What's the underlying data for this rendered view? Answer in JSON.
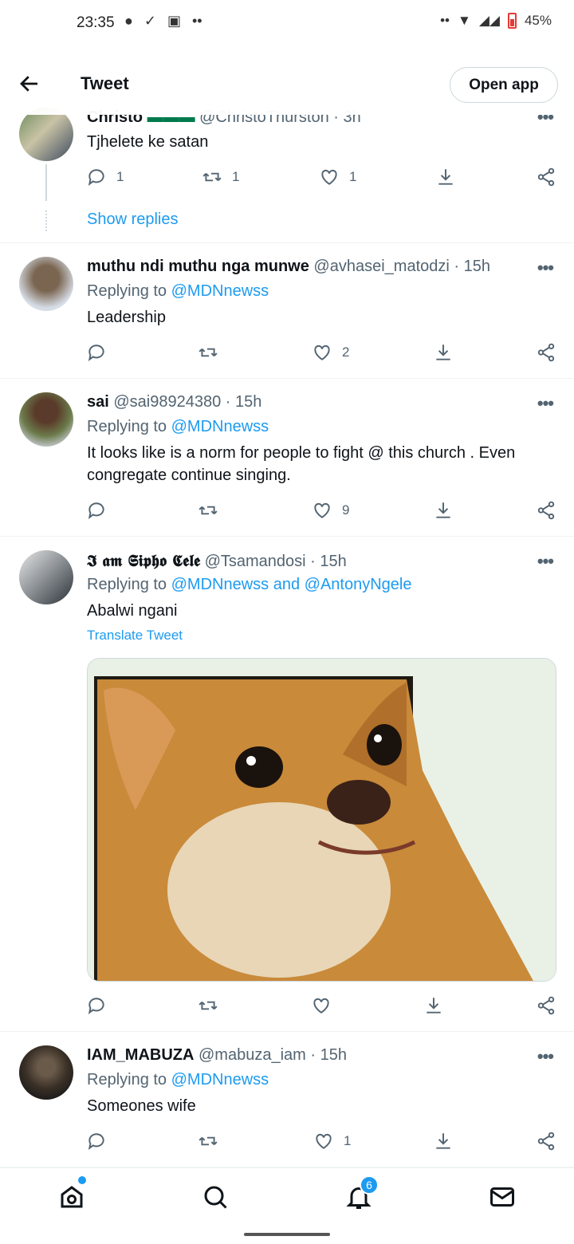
{
  "status_bar": {
    "time": "23:35",
    "battery": "45%"
  },
  "header": {
    "title": "Tweet",
    "open_app": "Open app"
  },
  "tweets": [
    {
      "name": "Christo",
      "handle": "@ChristoThurston · 3h",
      "text": "Tjhelete ke satan",
      "counts": {
        "reply": "1",
        "retweet": "1",
        "like": "1"
      },
      "show_replies": "Show replies"
    },
    {
      "name": "muthu ndi muthu nga munwe",
      "handle": "@avhasei_matodzi · 15h",
      "replying_prefix": "Replying to",
      "replying_to": "@MDNnewss",
      "text": "Leadership",
      "counts": {
        "reply": "",
        "retweet": "",
        "like": "2"
      }
    },
    {
      "name": "sai",
      "handle": "@sai98924380 · 15h",
      "replying_prefix": "Replying to",
      "replying_to": "@MDNnewss",
      "text": "It looks like is a norm for people to fight @ this church . Even congregate continue singing.",
      "counts": {
        "reply": "",
        "retweet": "",
        "like": "9"
      }
    },
    {
      "name": "𝕴 𝖆𝖒 𝕾𝖎𝖕𝖍𝖔 𝕮𝖊𝖑𝖊",
      "handle": "@Tsamandosi · 15h",
      "replying_prefix": "Replying to",
      "replying_to": "@MDNnewss and @AntonyNgele",
      "text": "Abalwi ngani",
      "translate": "Translate Tweet",
      "counts": {
        "reply": "",
        "retweet": "",
        "like": ""
      }
    },
    {
      "name": "IAM_MABUZA",
      "handle": "@mabuza_iam · 15h",
      "replying_prefix": "Replying to",
      "replying_to": "@MDNnewss",
      "text": "Someones wife",
      "counts": {
        "reply": "",
        "retweet": "",
        "like": "1"
      }
    }
  ],
  "bottom_nav": {
    "notifications_badge": "6"
  },
  "colors": {
    "accent": "#1d9bf0",
    "muted": "#536471",
    "text": "#0f1419"
  }
}
